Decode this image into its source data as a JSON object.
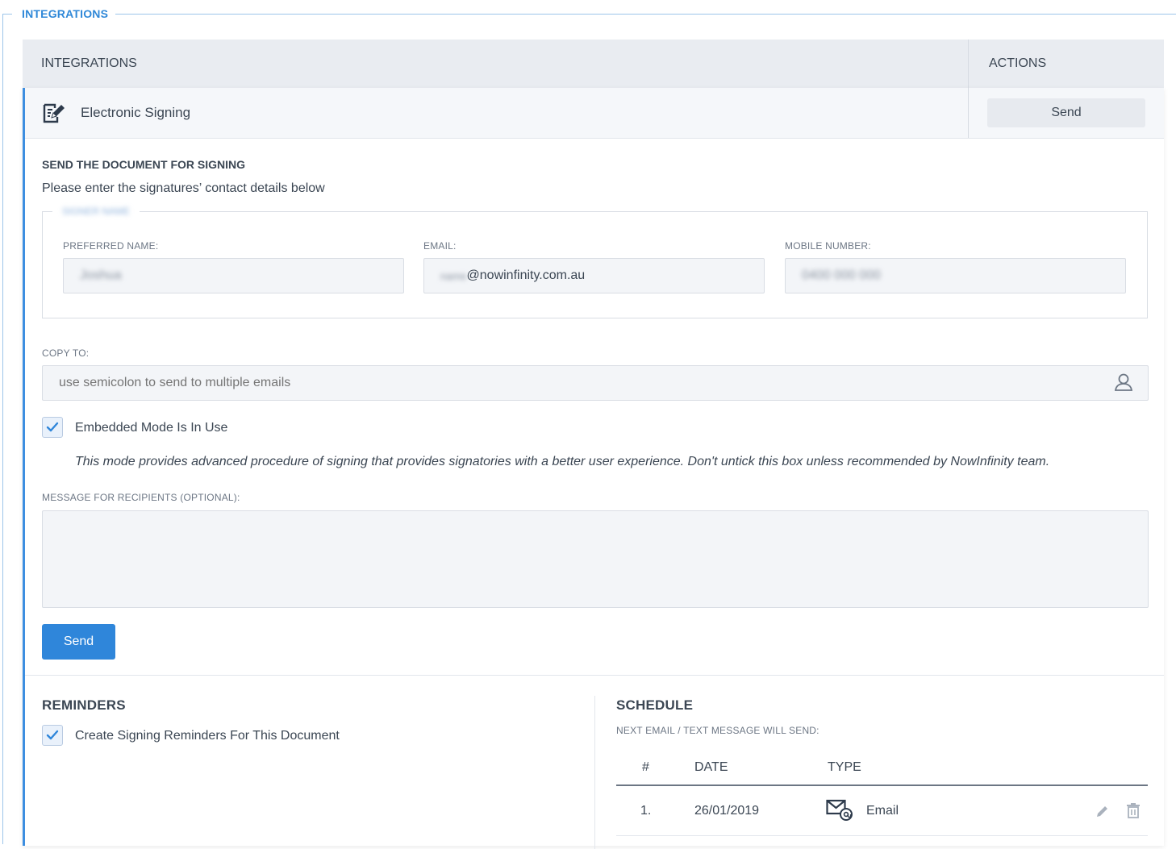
{
  "section": {
    "title": "INTEGRATIONS"
  },
  "table": {
    "col_integrations": "INTEGRATIONS",
    "col_actions": "ACTIONS",
    "row": {
      "name": "Electronic Signing",
      "icon": "signing-document-icon",
      "action_label": "Send"
    }
  },
  "form": {
    "title": "SEND THE DOCUMENT FOR SIGNING",
    "subtitle": "Please enter the signatures’ contact details below",
    "contact_legend": "SIGNER NAME",
    "preferred_name_label": "PREFERRED NAME:",
    "preferred_name_value": "Joshua",
    "email_label": "EMAIL:",
    "email_prefix_blurred": "name",
    "email_value": "@nowinfinity.com.au",
    "mobile_label": "MOBILE NUMBER:",
    "mobile_value": "0400 000 000",
    "copy_to_label": "COPY TO:",
    "copy_to_placeholder": "use semicolon to send to multiple emails",
    "embedded_label": "Embedded Mode Is In Use",
    "embedded_checked": true,
    "embedded_note": "This mode provides advanced procedure of signing that provides signatories with a better user experience. Don't untick this box unless recommended by NowInfinity team.",
    "message_label": "MESSAGE FOR RECIPIENTS (OPTIONAL):",
    "message_value": "",
    "send_label": "Send"
  },
  "reminders": {
    "title": "REMINDERS",
    "checkbox_label": "Create Signing Reminders For This Document",
    "checked": true
  },
  "schedule": {
    "title": "SCHEDULE",
    "subtitle": "NEXT EMAIL / TEXT MESSAGE WILL SEND:",
    "headers": {
      "num": "#",
      "date": "DATE",
      "type": "TYPE"
    },
    "rows": [
      {
        "num": "1.",
        "date": "26/01/2019",
        "type": "Email",
        "type_icon": "email-at-icon"
      }
    ]
  },
  "colors": {
    "accent": "#2f86da",
    "legend": "#2f88d8",
    "text": "#3b4653"
  }
}
